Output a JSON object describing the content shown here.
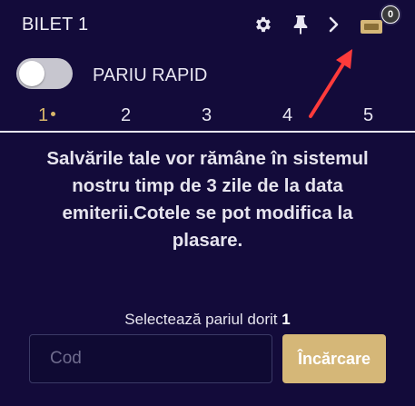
{
  "header": {
    "title": "BILET 1",
    "icons": [
      "gear-icon",
      "pin-icon",
      "chevron-right-icon",
      "ticket-icon"
    ],
    "badge_count": "0"
  },
  "quick_bet": {
    "label": "PARIU RAPID",
    "enabled": false
  },
  "tabs": [
    {
      "label": "1",
      "active": true
    },
    {
      "label": "2",
      "active": false
    },
    {
      "label": "3",
      "active": false
    },
    {
      "label": "4",
      "active": false
    },
    {
      "label": "5",
      "active": false
    }
  ],
  "message": "Salvările tale vor rămâne în sistemul nostru timp de 3 zile de la data emiterii.Cotele se pot modifica la plasare.",
  "select_prompt": {
    "text": "Selectează pariul dorit",
    "number": "1"
  },
  "code_input": {
    "placeholder": "Cod",
    "value": ""
  },
  "load_button": "Încărcare",
  "colors": {
    "background": "#130b3a",
    "accent_gold": "#d5b778",
    "annotation_arrow": "#ff3b3b"
  }
}
